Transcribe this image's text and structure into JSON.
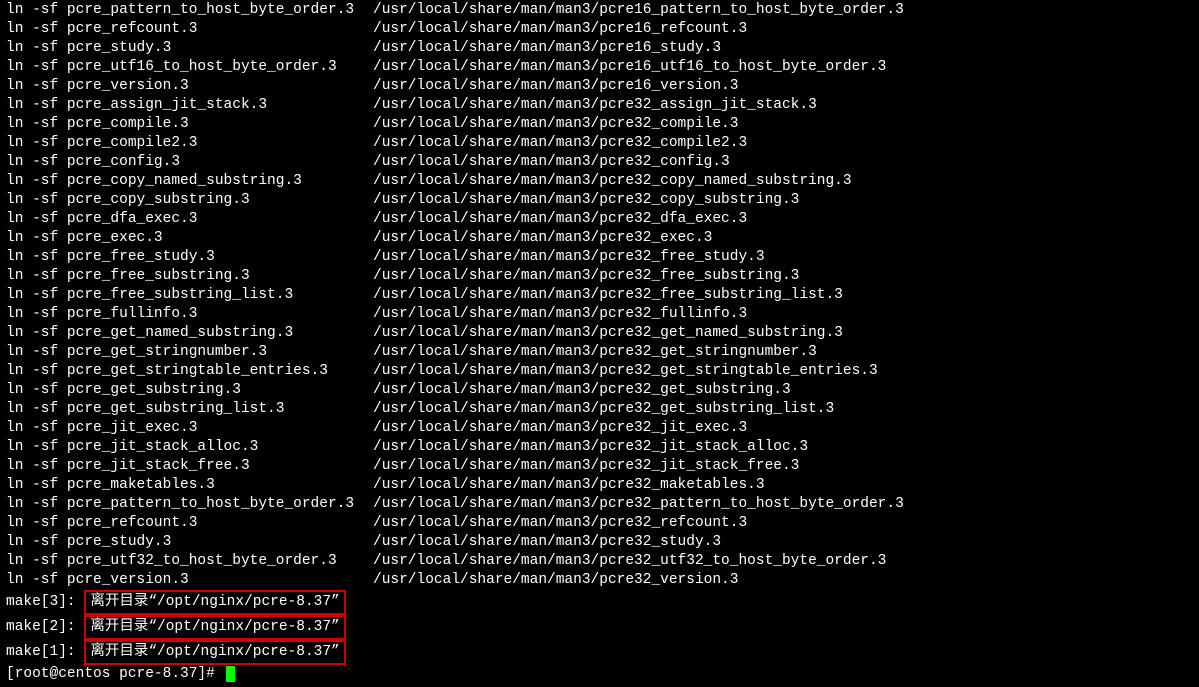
{
  "lines": [
    {
      "left": "ln -sf pcre_pattern_to_host_byte_order.3",
      "right": "/usr/local/share/man/man3/pcre16_pattern_to_host_byte_order.3"
    },
    {
      "left": "ln -sf pcre_refcount.3",
      "right": "/usr/local/share/man/man3/pcre16_refcount.3"
    },
    {
      "left": "ln -sf pcre_study.3",
      "right": "/usr/local/share/man/man3/pcre16_study.3"
    },
    {
      "left": "ln -sf pcre_utf16_to_host_byte_order.3",
      "right": "/usr/local/share/man/man3/pcre16_utf16_to_host_byte_order.3"
    },
    {
      "left": "ln -sf pcre_version.3",
      "right": "/usr/local/share/man/man3/pcre16_version.3"
    },
    {
      "left": "ln -sf pcre_assign_jit_stack.3",
      "right": "/usr/local/share/man/man3/pcre32_assign_jit_stack.3"
    },
    {
      "left": "ln -sf pcre_compile.3",
      "right": "/usr/local/share/man/man3/pcre32_compile.3"
    },
    {
      "left": "ln -sf pcre_compile2.3",
      "right": "/usr/local/share/man/man3/pcre32_compile2.3"
    },
    {
      "left": "ln -sf pcre_config.3",
      "right": "/usr/local/share/man/man3/pcre32_config.3"
    },
    {
      "left": "ln -sf pcre_copy_named_substring.3",
      "right": "/usr/local/share/man/man3/pcre32_copy_named_substring.3"
    },
    {
      "left": "ln -sf pcre_copy_substring.3",
      "right": "/usr/local/share/man/man3/pcre32_copy_substring.3"
    },
    {
      "left": "ln -sf pcre_dfa_exec.3",
      "right": "/usr/local/share/man/man3/pcre32_dfa_exec.3"
    },
    {
      "left": "ln -sf pcre_exec.3",
      "right": "/usr/local/share/man/man3/pcre32_exec.3"
    },
    {
      "left": "ln -sf pcre_free_study.3",
      "right": "/usr/local/share/man/man3/pcre32_free_study.3"
    },
    {
      "left": "ln -sf pcre_free_substring.3",
      "right": "/usr/local/share/man/man3/pcre32_free_substring.3"
    },
    {
      "left": "ln -sf pcre_free_substring_list.3",
      "right": "/usr/local/share/man/man3/pcre32_free_substring_list.3"
    },
    {
      "left": "ln -sf pcre_fullinfo.3",
      "right": "/usr/local/share/man/man3/pcre32_fullinfo.3"
    },
    {
      "left": "ln -sf pcre_get_named_substring.3",
      "right": "/usr/local/share/man/man3/pcre32_get_named_substring.3"
    },
    {
      "left": "ln -sf pcre_get_stringnumber.3",
      "right": "/usr/local/share/man/man3/pcre32_get_stringnumber.3"
    },
    {
      "left": "ln -sf pcre_get_stringtable_entries.3",
      "right": "/usr/local/share/man/man3/pcre32_get_stringtable_entries.3"
    },
    {
      "left": "ln -sf pcre_get_substring.3",
      "right": "/usr/local/share/man/man3/pcre32_get_substring.3"
    },
    {
      "left": "ln -sf pcre_get_substring_list.3",
      "right": "/usr/local/share/man/man3/pcre32_get_substring_list.3"
    },
    {
      "left": "ln -sf pcre_jit_exec.3",
      "right": "/usr/local/share/man/man3/pcre32_jit_exec.3"
    },
    {
      "left": "ln -sf pcre_jit_stack_alloc.3",
      "right": "/usr/local/share/man/man3/pcre32_jit_stack_alloc.3"
    },
    {
      "left": "ln -sf pcre_jit_stack_free.3",
      "right": "/usr/local/share/man/man3/pcre32_jit_stack_free.3"
    },
    {
      "left": "ln -sf pcre_maketables.3",
      "right": "/usr/local/share/man/man3/pcre32_maketables.3"
    },
    {
      "left": "ln -sf pcre_pattern_to_host_byte_order.3",
      "right": "/usr/local/share/man/man3/pcre32_pattern_to_host_byte_order.3"
    },
    {
      "left": "ln -sf pcre_refcount.3",
      "right": "/usr/local/share/man/man3/pcre32_refcount.3"
    },
    {
      "left": "ln -sf pcre_study.3",
      "right": "/usr/local/share/man/man3/pcre32_study.3"
    },
    {
      "left": "ln -sf pcre_utf32_to_host_byte_order.3",
      "right": "/usr/local/share/man/man3/pcre32_utf32_to_host_byte_order.3"
    },
    {
      "left": "ln -sf pcre_version.3",
      "right": "/usr/local/share/man/man3/pcre32_version.3"
    }
  ],
  "make_lines": [
    {
      "pre": "make[3]: ",
      "msg": "离开目录“/opt/nginx/pcre-8.37”"
    },
    {
      "pre": "make[2]: ",
      "msg": "离开目录“/opt/nginx/pcre-8.37”"
    },
    {
      "pre": "make[1]: ",
      "msg": "离开目录“/opt/nginx/pcre-8.37”"
    }
  ],
  "prompt": "[root@centos pcre-8.37]# "
}
